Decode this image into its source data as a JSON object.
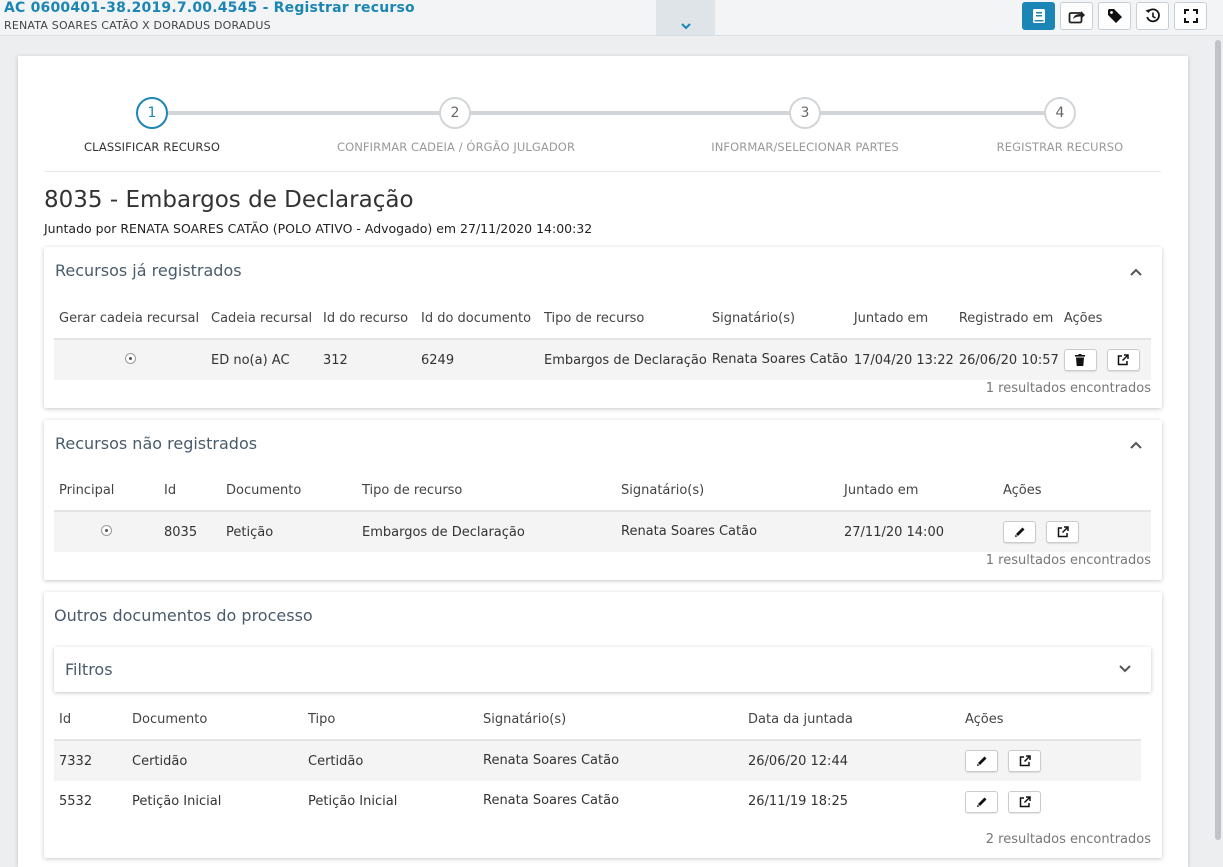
{
  "header": {
    "title": "AC 0600401-38.2019.7.00.4545 - Registrar recurso",
    "subtitle": "RENATA SOARES CATÃO X DORADUS DORADUS",
    "tools": [
      "book-icon",
      "share-icon",
      "tag-icon",
      "history-icon",
      "fullscreen-icon"
    ],
    "accent": "#1b86b5"
  },
  "stepper": [
    {
      "num": "1",
      "label": "CLASSIFICAR RECURSO"
    },
    {
      "num": "2",
      "label": "CONFIRMAR CADEIA / ÓRGÃO JULGADOR"
    },
    {
      "num": "3",
      "label": "INFORMAR/SELECIONAR PARTES"
    },
    {
      "num": "4",
      "label": "REGISTRAR RECURSO"
    }
  ],
  "page": {
    "heading": "8035 - Embargos de Declaração",
    "joined": "Juntado por RENATA SOARES CATÃO (POLO ATIVO - Advogado) em 27/11/2020 14:00:32"
  },
  "registered": {
    "title": "Recursos já registrados",
    "columns": [
      "Gerar cadeia recursal",
      "Cadeia recursal",
      "Id do recurso",
      "Id do documento",
      "Tipo de recurso",
      "Signatário(s)",
      "Juntado em",
      "Registrado em",
      "Ações"
    ],
    "rows": [
      {
        "cadeia": "ED no(a) AC",
        "id_recurso": "312",
        "id_documento": "6249",
        "tipo": "Embargos de Declaração",
        "signatario": "Renata Soares Catão",
        "juntado": "17/04/20 13:22",
        "registrado": "26/06/20 10:57"
      }
    ],
    "results": "1 resultados encontrados"
  },
  "unregistered": {
    "title": "Recursos não registrados",
    "columns": [
      "Principal",
      "Id",
      "Documento",
      "Tipo de recurso",
      "Signatário(s)",
      "Juntado em",
      "Ações"
    ],
    "rows": [
      {
        "id": "8035",
        "documento": "Petição",
        "tipo": "Embargos de Declaração",
        "signatario": "Renata Soares Catão",
        "juntado": "27/11/20 14:00"
      }
    ],
    "results": "1 resultados encontrados"
  },
  "others": {
    "title": "Outros documentos do processo",
    "filters_label": "Filtros",
    "columns": [
      "Id",
      "Documento",
      "Tipo",
      "Signatário(s)",
      "Data da juntada",
      "Ações"
    ],
    "rows": [
      {
        "id": "7332",
        "documento": "Certidão",
        "tipo": "Certidão",
        "signatario": "Renata Soares Catão",
        "data": "26/06/20 12:44"
      },
      {
        "id": "5532",
        "documento": "Petição Inicial",
        "tipo": "Petição Inicial",
        "signatario": "Renata Soares Catão",
        "data": "26/11/19 18:25"
      }
    ],
    "results": "2 resultados encontrados"
  }
}
